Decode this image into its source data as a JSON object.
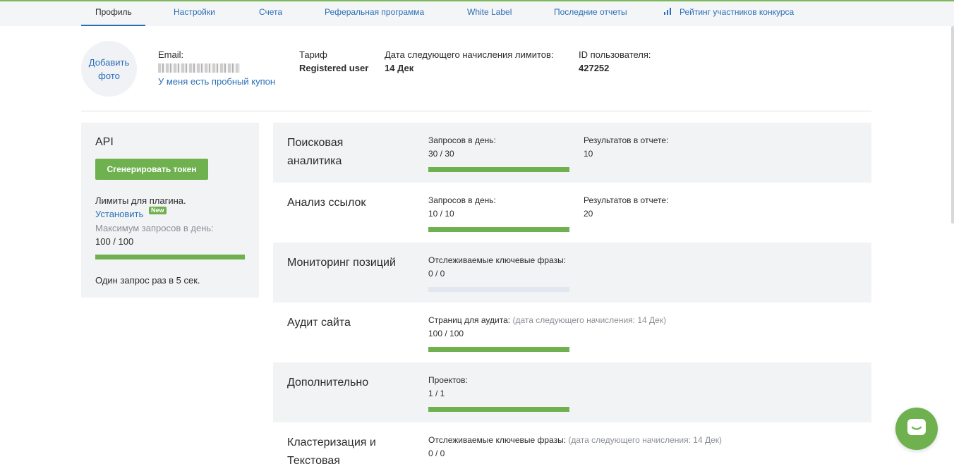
{
  "tabs": [
    {
      "label": "Профиль",
      "active": true
    },
    {
      "label": "Настройки"
    },
    {
      "label": "Счета"
    },
    {
      "label": "Реферальная программа"
    },
    {
      "label": "White Label"
    },
    {
      "label": "Последние отчеты"
    },
    {
      "label": "Рейтинг участников конкурса",
      "icon": "bar-chart-icon"
    }
  ],
  "profile": {
    "avatar_label": "Добавить фото",
    "email_label": "Email:",
    "coupon_link": "У меня есть пробный купон",
    "tariff_label": "Тариф",
    "tariff_value": "Registered user",
    "next_limits_label": "Дата следующего начисления лимитов:",
    "next_limits_value": "14 Дек",
    "user_id_label": "ID пользователя:",
    "user_id_value": "427252"
  },
  "api": {
    "title": "API",
    "generate_button": "Сгенерировать токен",
    "plugin_limits": "Лимиты для плагина.",
    "install_link": "Установить",
    "new_badge": "New",
    "max_requests_label": "Максимум запросов в день:",
    "max_requests_value": "100 / 100",
    "max_requests_fill": 1.0,
    "rate_note": "Один запрос раз в 5 сек."
  },
  "limits": [
    {
      "title": "Поисковая аналитика",
      "metrics": [
        {
          "label": "Запросов в день:",
          "value": "30 / 30",
          "fill": 1.0
        },
        {
          "label": "Результатов в отчете:",
          "value": "10"
        }
      ]
    },
    {
      "title": "Анализ ссылок",
      "metrics": [
        {
          "label": "Запросов в день:",
          "value": "10 / 10",
          "fill": 1.0
        },
        {
          "label": "Результатов в отчете:",
          "value": "20"
        }
      ]
    },
    {
      "title": "Мониторинг позиций",
      "metrics": [
        {
          "label": "Отслеживаемые ключевые фразы:",
          "value": "0 / 0",
          "fill": 0.0
        }
      ]
    },
    {
      "title": "Аудит сайта",
      "metrics": [
        {
          "label": "Страниц для аудита:",
          "note": "(дата следующего начисления: 14 Дек)",
          "value": "100 / 100",
          "fill": 1.0
        }
      ]
    },
    {
      "title": "Дополнительно",
      "metrics": [
        {
          "label": "Проектов:",
          "value": "1 / 1",
          "fill": 1.0
        }
      ]
    },
    {
      "title": "Кластеризация и Текстовая",
      "metrics": [
        {
          "label": "Отслеживаемые ключевые фразы:",
          "note": "(дата следующего начисления: 14 Дек)",
          "value": "0 / 0"
        }
      ]
    }
  ],
  "colors": {
    "accent": "#2a6fb8",
    "green": "#6fb14f",
    "panel": "#f2f3f5"
  }
}
